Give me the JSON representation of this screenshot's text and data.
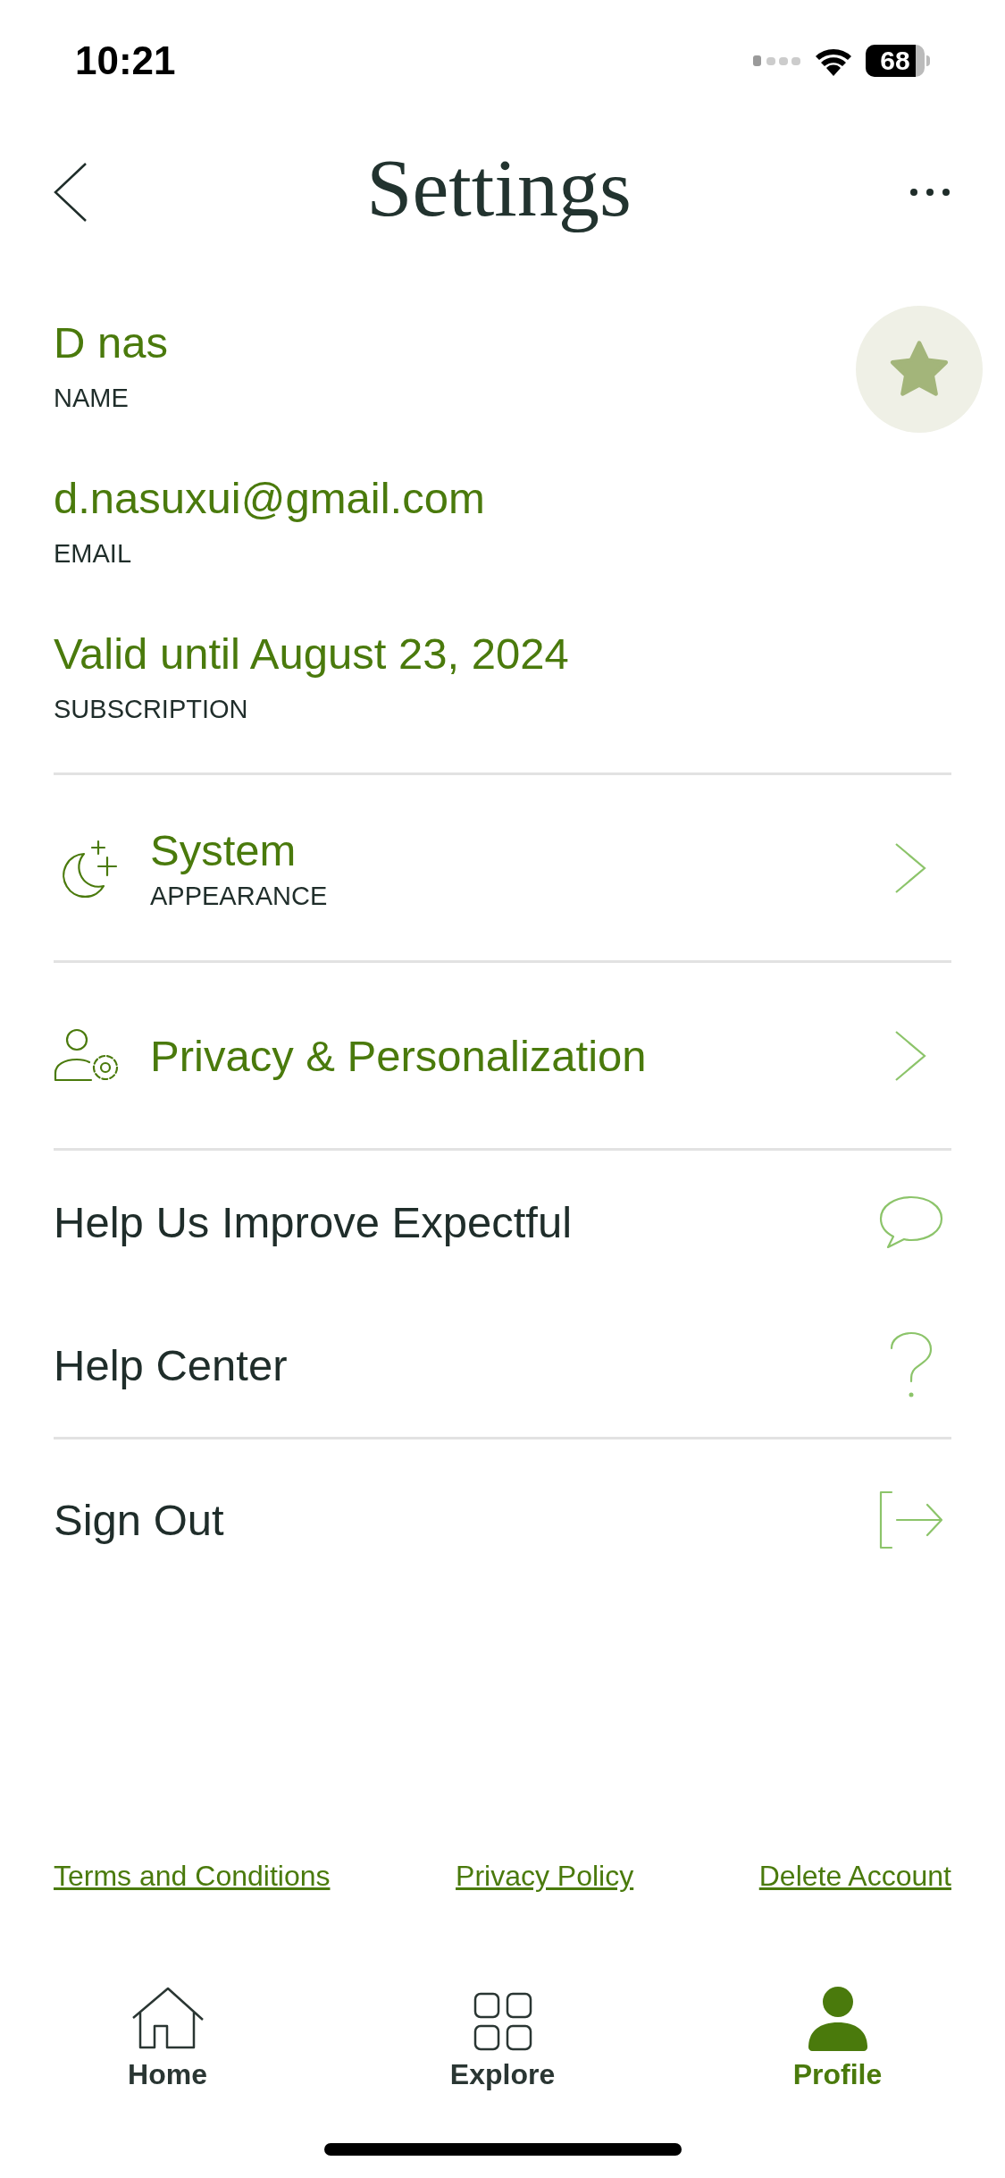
{
  "status_bar": {
    "time": "10:21",
    "battery": "68"
  },
  "header": {
    "title": "Settings"
  },
  "profile": [
    {
      "value": "D nas",
      "label": "NAME"
    },
    {
      "value": "d.nasuxui@gmail.com",
      "label": "EMAIL"
    },
    {
      "value": "Valid until August 23, 2024",
      "label": "SUBSCRIPTION"
    }
  ],
  "settings_groups": [
    [
      {
        "kind": "nav",
        "title": "System",
        "subtitle": "APPEARANCE"
      }
    ],
    [
      {
        "kind": "nav",
        "title": "Privacy & Personalization"
      }
    ],
    [
      {
        "kind": "action",
        "title": "Help Us Improve Expectful"
      },
      {
        "kind": "action",
        "title": "Help Center"
      }
    ],
    [
      {
        "kind": "action",
        "title": "Sign Out"
      }
    ]
  ],
  "links": [
    "Terms and Conditions",
    "Privacy Policy",
    "Delete Account"
  ],
  "tabs": [
    {
      "label": "Home",
      "selected": false
    },
    {
      "label": "Explore",
      "selected": false
    },
    {
      "label": "Profile",
      "selected": true
    }
  ]
}
